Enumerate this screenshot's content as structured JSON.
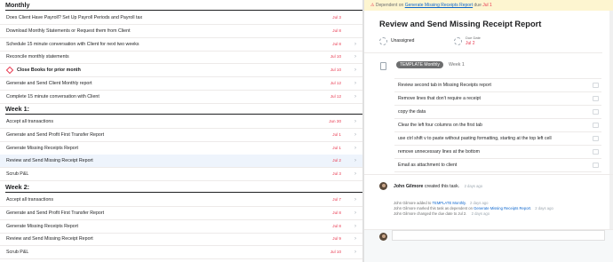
{
  "colors": {
    "accent": "#e8384f",
    "link": "#0d66ce",
    "selected_bg": "#eef4fc",
    "banner_bg": "#fdf5d0"
  },
  "list": {
    "sections": [
      {
        "title": "Monthly",
        "tasks": [
          {
            "name": "Does Client Have Payroll? Set Up Payroll Periods and Payroll tax",
            "date": "Jul 3",
            "chevron": false
          },
          {
            "name": "Download Monthly Statements or Request them from Client",
            "date": "Jul 8",
            "chevron": false
          },
          {
            "name": "Schedule 15 minute conversation with Client for next two weeks",
            "date": "Jul 8",
            "chevron": true
          },
          {
            "name": "Reconcile monthly statements",
            "date": "Jul 10",
            "chevron": true
          },
          {
            "name": "Close Books for prior month",
            "date": "Jul 10",
            "chevron": true,
            "milestone": true
          },
          {
            "name": "Generate and Send Client Monthly report",
            "date": "Jul 12",
            "chevron": true
          },
          {
            "name": "Complete 15 minute conversation with Client",
            "date": "Jul 12",
            "chevron": true
          }
        ]
      },
      {
        "title": "Week 1:",
        "tasks": [
          {
            "name": "Accept all transactions",
            "date": "Jun 30",
            "chevron": true
          },
          {
            "name": "Generate and Send Profit First Transfer Report",
            "date": "Jul 1",
            "chevron": true
          },
          {
            "name": "Generate Missing Receipts Report",
            "date": "Jul 1",
            "chevron": true
          },
          {
            "name": "Review and Send Missing Receipt Report",
            "date": "Jul 2",
            "chevron": true,
            "selected": true
          },
          {
            "name": "Scrub P&L",
            "date": "Jul 3",
            "chevron": true
          }
        ]
      },
      {
        "title": "Week 2:",
        "tasks": [
          {
            "name": "Accept all transactions",
            "date": "Jul 7",
            "chevron": true
          },
          {
            "name": "Generate and Send Profit First Transfer Report",
            "date": "Jul 8",
            "chevron": true
          },
          {
            "name": "Generate Missing Receipts Report",
            "date": "Jul 8",
            "chevron": true
          },
          {
            "name": "Review and Send Missing Receipt Report",
            "date": "Jul 9",
            "chevron": true
          },
          {
            "name": "Scrub P&L",
            "date": "Jul 10",
            "chevron": true
          }
        ]
      }
    ]
  },
  "detail": {
    "banner": {
      "prefix": "Dependent on",
      "task": "Generate Missing Receipts Report",
      "due_prefix": "due",
      "due": "Jul 1"
    },
    "title": "Review and Send Missing Receipt Report",
    "assignee": "Unassigned",
    "due_label": "Due Date",
    "due_value": "Jul 2",
    "tag": "TEMPLATE Monthly",
    "week": "Week 1",
    "subtasks": [
      "Review second tab in Missing Receipts report",
      "Remove lines that don't require a receipt",
      "copy the data",
      "Clear the left four columns on the first tab",
      "use ctrl shift v to paste without pasting formatting, starting at the top left cell",
      "remove unnecessary lines at the bottom",
      "Email as attachment to client"
    ],
    "activity": {
      "author": "John Gilmore",
      "created": "created this task.",
      "created_ago": "2 days ago",
      "lines": [
        {
          "text": "John Gilmore added to",
          "link": "TEMPLATE Monthly",
          "tail": ".",
          "ago": "2 days ago"
        },
        {
          "text": "John Gilmore marked this task as dependent on",
          "link": "Generate Missing Receipts Report",
          "tail": ".",
          "ago": "2 days ago"
        },
        {
          "text": "John Gilmore changed the due date to Jul 2.",
          "link": "",
          "tail": "",
          "ago": "2 days ago"
        }
      ]
    }
  }
}
